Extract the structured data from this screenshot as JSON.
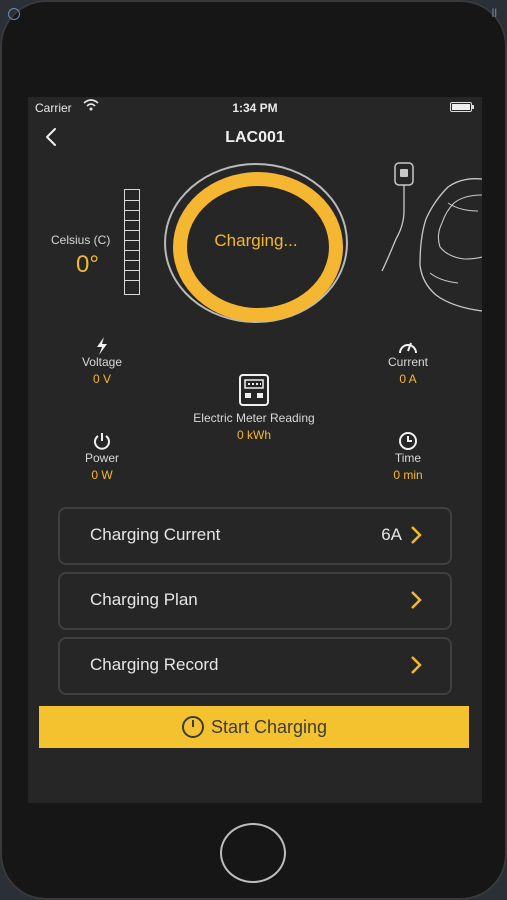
{
  "status": {
    "carrier": "Carrier",
    "time": "1:34 PM"
  },
  "nav": {
    "title": "LAC001"
  },
  "temperature": {
    "label": "Celsius (C)",
    "value": "0°"
  },
  "status_ring": {
    "text": "Charging..."
  },
  "metrics": {
    "voltage": {
      "label": "Voltage",
      "value": "0 V"
    },
    "current": {
      "label": "Current",
      "value": "0 A"
    },
    "meter": {
      "label": "Electric Meter Reading",
      "value": "0 kWh"
    },
    "power": {
      "label": "Power",
      "value": "0 W"
    },
    "time": {
      "label": "Time",
      "value": "0 min"
    }
  },
  "settings": {
    "charging_current": {
      "label": "Charging Current",
      "value": "6A"
    },
    "charging_plan": {
      "label": "Charging Plan"
    },
    "charging_record": {
      "label": "Charging Record"
    }
  },
  "actions": {
    "start_label": "Start Charging"
  },
  "colors": {
    "accent": "#f5b731",
    "button": "#f5c22f",
    "background": "#262626",
    "text": "#e6e6e6"
  },
  "icons": [
    "wifi-icon",
    "battery-icon",
    "back-chevron-icon",
    "thermometer-icon",
    "car-charger-icon",
    "lightning-icon",
    "gauge-icon",
    "meter-icon",
    "power-icon",
    "clock-icon",
    "chevron-right-icon"
  ]
}
